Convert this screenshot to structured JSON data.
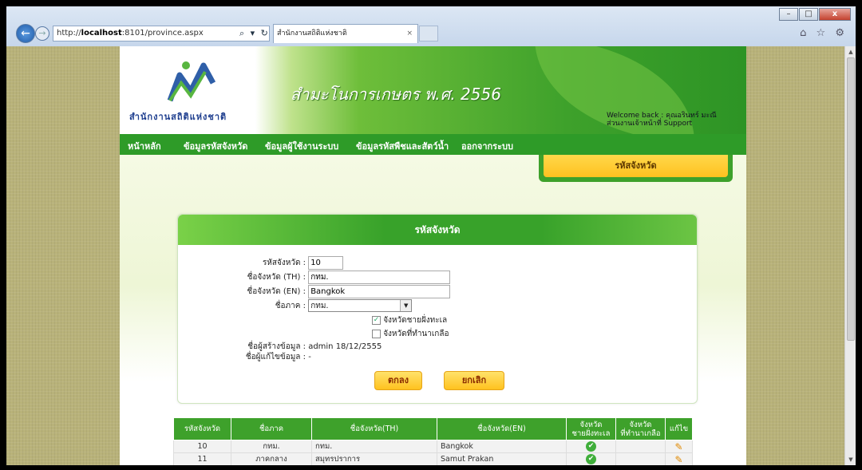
{
  "browser": {
    "url_prefix": "http://",
    "url_host": "localhost",
    "url_rest": ":8101/province.aspx",
    "address_controls": "⌕ ▾ ↻ ✕",
    "tab_title": "สำนักงานสถิติแห่งชาติ",
    "tab_close": "×",
    "right_icons": "⌂ ☆ ⚙",
    "win_min": "–",
    "win_max": "□",
    "win_close": "x"
  },
  "header": {
    "logo_text": "สำนักงานสถิติแห่งชาติ",
    "title": "สำมะโนการเกษตร พ.ศ. 2556",
    "welcome_line1": "Welcome back : คุณอรินทร์ มะณี",
    "welcome_line2": "ส่วนงานเจ้าหน้าที่ Support"
  },
  "menu": [
    "หน้าหลัก",
    "ข้อมูลรหัสจังหวัด",
    "ข้อมูลผู้ใช้งานระบบ",
    "ข้อมูลรหัสพืชและสัตว์น้ำ",
    "ออกจากระบบ"
  ],
  "side_tab": "รหัสจังหวัด",
  "form": {
    "title": "รหัสจังหวัด",
    "code_label": "รหัสจังหวัด :",
    "code_value": "10",
    "name_th_label": "ชื่อจังหวัด (TH) :",
    "name_th_value": "กทม.",
    "name_en_label": "ชื่อจังหวัด (EN) :",
    "name_en_value": "Bangkok",
    "region_label": "ชื่อภาค :",
    "region_value": "กทม.",
    "coastal_label": "จังหวัดชายฝั่งทะเล",
    "salt_label": "จังหวัดที่ทำนาเกลือ",
    "created_label": "ชื่อผู้สร้างข้อมูล :",
    "created_value": "admin 18/12/2555",
    "edited_label": "ชื่อผู้แก้ไขข้อมูล :",
    "edited_value": "-",
    "ok_button": "ตกลง",
    "cancel_button": "ยกเลิก"
  },
  "table": {
    "headers": [
      "รหัสจังหวัด",
      "ชื่อภาค",
      "ชื่อจังหวัด(TH)",
      "ชื่อจังหวัด(EN)",
      "จังหวัด\nชายฝั่งทะเล",
      "จังหวัด\nที่ทำนาเกลือ",
      "แก้ไข"
    ],
    "rows": [
      {
        "code": "10",
        "region": "กทม.",
        "name_th": "กทม.",
        "name_en": "Bangkok",
        "coastal": true,
        "salt": false
      },
      {
        "code": "11",
        "region": "ภาคกลาง",
        "name_th": "สมุทรปราการ",
        "name_en": "Samut Prakan",
        "coastal": true,
        "salt": false
      }
    ]
  },
  "icons": {
    "check": "check-circle-icon",
    "edit": "pencil-icon",
    "checkbox_mark": "✓",
    "ok_mark": "✔",
    "edit_mark": "✎",
    "dropdown_mark": "▼"
  },
  "colors": {
    "menu_green": "#2e9b28",
    "button_yellow": "#ffc21f",
    "page_bg": "#b8b27a"
  }
}
